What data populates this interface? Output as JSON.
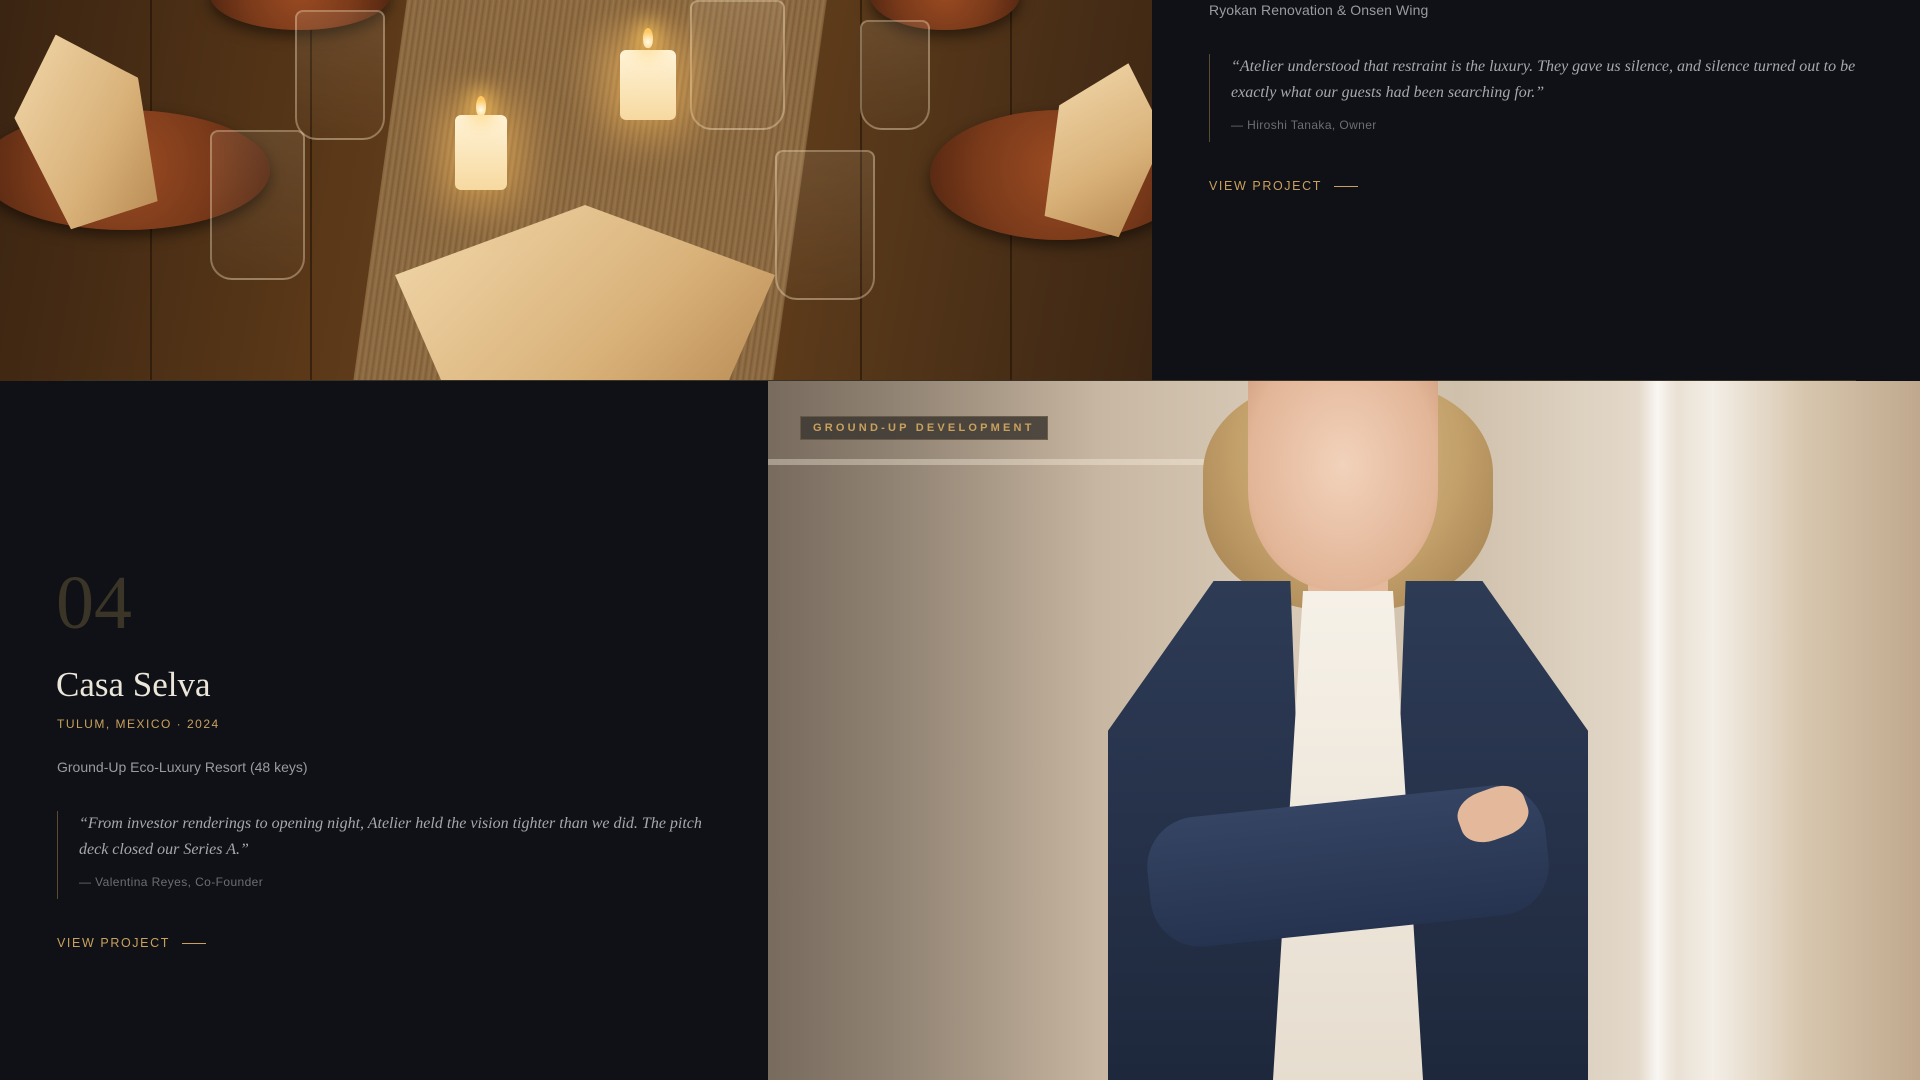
{
  "featured_project": {
    "subtitle": "Ryokan Renovation & Onsen Wing",
    "quote": "“Atelier understood that restraint is the luxury. They gave us silence, and silence turned out to be exactly what our guests had been searching for.”",
    "attribution": "— Hiroshi Tanaka, Owner",
    "cta": "VIEW PROJECT",
    "image_icon": "candlelit-dining-table-image"
  },
  "project": {
    "number": "04",
    "title": "Casa Selva",
    "meta": "TULUM, MEXICO · 2024",
    "subtitle": "Ground-Up Eco-Luxury Resort (48 keys)",
    "quote": "“From investor renderings to opening night, Atelier held the vision tighter than we did. The pitch deck closed our Series A.”",
    "attribution": "— Valentina Reyes, Co-Founder",
    "cta": "VIEW PROJECT",
    "category_tag": "GROUND-UP DEVELOPMENT",
    "image_icon": "portrait-photo-image"
  },
  "colors": {
    "background": "#0f1117",
    "accent_gold": "#c9a15c",
    "title_text": "#ece6da",
    "muted_text": "#9a9aa0",
    "number_text": "#3b3527"
  }
}
